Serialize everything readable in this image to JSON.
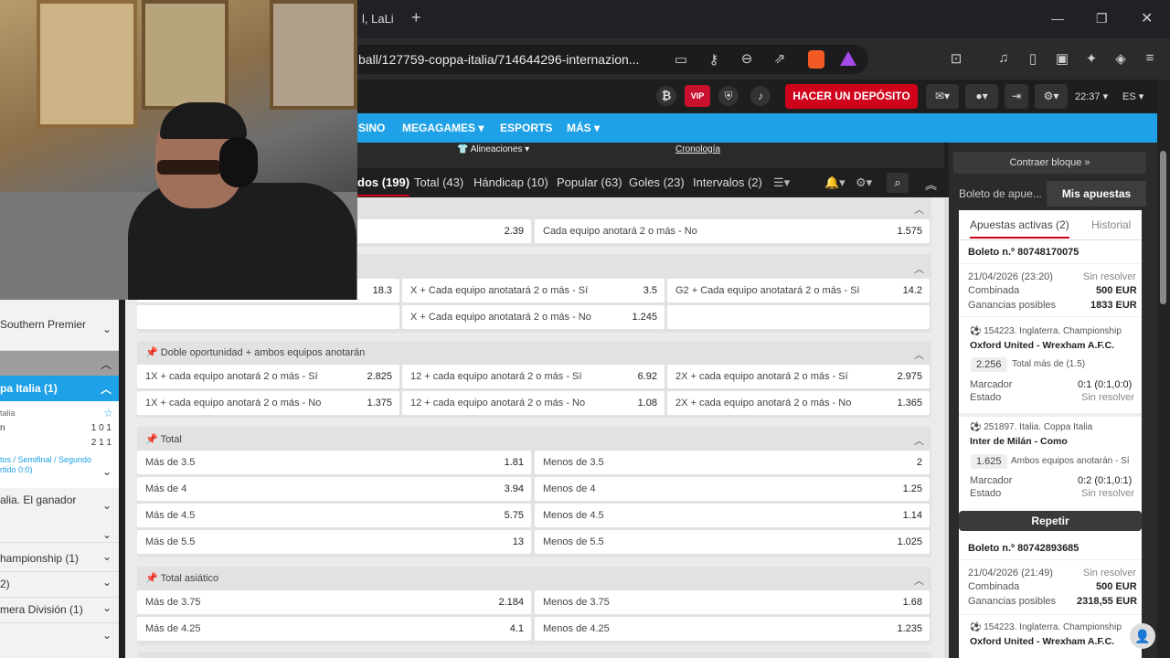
{
  "browser": {
    "tab_title": "l, LaLi",
    "url": "ball/127759-coppa-italia/714644296-internazion..."
  },
  "header": {
    "deposit_button": "HACER UN DEPÓSITO",
    "vip_label": "VIP",
    "time": "22:37",
    "lang": "ES"
  },
  "nav": [
    "SINO",
    "MEGAGAMES",
    "ESPORTS",
    "MÁS"
  ],
  "match_bar": {
    "lineups": "Alineaciones",
    "timeline": "Cronología"
  },
  "tabs": [
    "dos (199)",
    "Total (43)",
    "Hándicap (10)",
    "Popular (63)",
    "Goles (23)",
    "Intervalos (2)"
  ],
  "left_panel": {
    "items": [
      "Southern Premier",
      "pa Italia (1)",
      "talia",
      "n",
      "1 0 1",
      "2 1 1",
      "tos / Semifinal / Segundo",
      "rtido 0:0)",
      "alia. El ganador",
      "hampionship (1)",
      "2)",
      "mera División (1)"
    ]
  },
  "markets": {
    "top_row": [
      {
        "label": "",
        "odd": "2.39"
      },
      {
        "label": "Cada equipo anotará 2 o más - No",
        "odd": "1.575"
      }
    ],
    "sec2_row1": [
      {
        "label": "",
        "odd": "18.3"
      },
      {
        "label": "X + Cada equipo anotatará 2 o más - Sí",
        "odd": "3.5"
      },
      {
        "label": "G2 + Cada equipo anotatará 2 o más - Sí",
        "odd": "14.2"
      }
    ],
    "sec2_row2": [
      {
        "label": "X + Cada equipo anotatará 2 o más - No",
        "odd": "1.245"
      }
    ],
    "double_chance": {
      "title": "Doble oportunidad + ambos equipos anotarán",
      "rows": [
        [
          {
            "label": "1X + cada equipo anotará 2 o más - Sí",
            "odd": "2.825"
          },
          {
            "label": "12 + cada equipo anotará 2 o más - Sí",
            "odd": "6.92"
          },
          {
            "label": "2X + cada equipo anotará 2 o más - Sí",
            "odd": "2.975"
          }
        ],
        [
          {
            "label": "1X + cada equipo anotará 2 o más - No",
            "odd": "1.375"
          },
          {
            "label": "12 + cada equipo anotará 2 o más - No",
            "odd": "1.08"
          },
          {
            "label": "2X + cada equipo anotará 2 o más - No",
            "odd": "1.365"
          }
        ]
      ]
    },
    "total": {
      "title": "Total",
      "rows": [
        [
          {
            "label": "Más de 3.5",
            "odd": "1.81"
          },
          {
            "label": "Menos de 3.5",
            "odd": "2"
          }
        ],
        [
          {
            "label": "Más de 4",
            "odd": "3.94"
          },
          {
            "label": "Menos de 4",
            "odd": "1.25"
          }
        ],
        [
          {
            "label": "Más de 4.5",
            "odd": "5.75"
          },
          {
            "label": "Menos de 4.5",
            "odd": "1.14"
          }
        ],
        [
          {
            "label": "Más de 5.5",
            "odd": "13"
          },
          {
            "label": "Menos de 5.5",
            "odd": "1.025"
          }
        ]
      ]
    },
    "asian_total": {
      "title": "Total asiático",
      "rows": [
        [
          {
            "label": "Más de 3.75",
            "odd": "2.184"
          },
          {
            "label": "Menos de 3.75",
            "odd": "1.68"
          }
        ],
        [
          {
            "label": "Más de 4.25",
            "odd": "4.1"
          },
          {
            "label": "Menos de 4.25",
            "odd": "1.235"
          }
        ]
      ]
    }
  },
  "betslip": {
    "collapse": "Contraer bloque",
    "tab_slip": "Boleto de apue...",
    "tab_mybets": "Mis apuestas",
    "active": "Apuestas activas (2)",
    "history": "Historial",
    "bet1": {
      "id": "Boleto n.º 80748170075",
      "date": "21/04/2026 (23:20)",
      "status": "Sin resolver",
      "type": "Combinada",
      "stake": "500 EUR",
      "win_label": "Ganancias posibles",
      "win": "1833 EUR",
      "ev1": {
        "league": "154223. Inglaterra. Championship",
        "teams": "Oxford United - Wrexham A.F.C.",
        "odd": "2.256",
        "market": "Total más de (1.5)",
        "score_label": "Marcador",
        "score": "0:1 (0:1,0:0)",
        "state_label": "Estado",
        "state": "Sin resolver"
      },
      "ev2": {
        "league": "251897. Italia. Coppa Italia",
        "teams": "Inter de Milán - Como",
        "odd": "1.625",
        "market": "Ambos equipos anotarán - Sí",
        "score_label": "Marcador",
        "score": "0:2 (0:1,0:1)",
        "state_label": "Estado",
        "state": "Sin resolver"
      }
    },
    "repeat": "Repetir",
    "bet2": {
      "id": "Boleto n.º 80742893685",
      "date": "21/04/2026 (21:49)",
      "status": "Sin resolver",
      "type": "Combinada",
      "stake": "500 EUR",
      "win_label": "Ganancias posibles",
      "win": "2318,55 EUR",
      "ev1": {
        "league": "154223. Inglaterra. Championship",
        "teams": "Oxford United - Wrexham A.F.C."
      }
    }
  }
}
